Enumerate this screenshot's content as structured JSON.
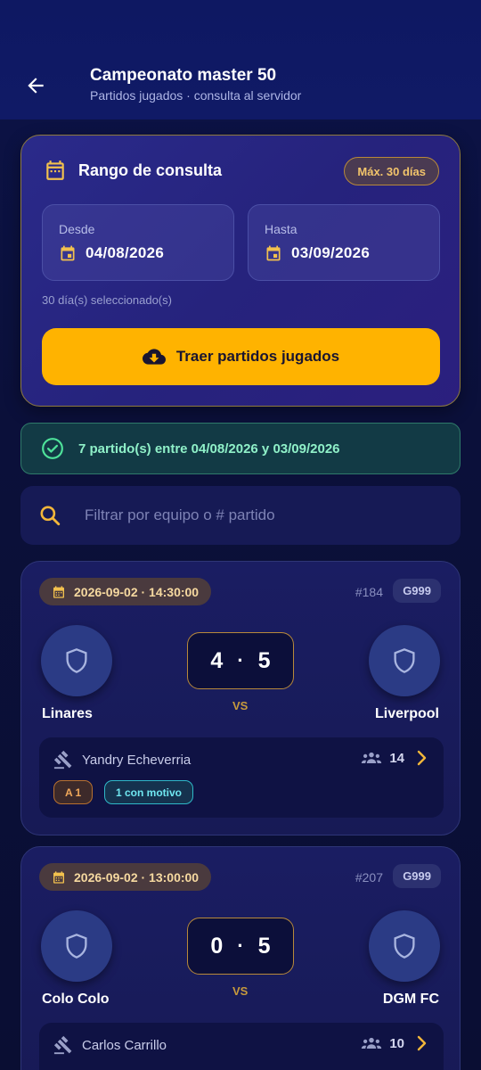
{
  "header": {
    "title": "Campeonato master 50",
    "subtitle": "Partidos jugados · consulta al servidor"
  },
  "range": {
    "title": "Rango de consulta",
    "max_badge": "Máx. 30 días",
    "from_label": "Desde",
    "from_value": "04/08/2026",
    "to_label": "Hasta",
    "to_value": "03/09/2026",
    "selected_count": "30 día(s) seleccionado(s)",
    "fetch_button": "Traer partidos jugados"
  },
  "result": {
    "text": "7 partido(s) entre 04/08/2026 y 03/09/2026"
  },
  "search": {
    "placeholder": "Filtrar por equipo o # partido",
    "value": ""
  },
  "matches": [
    {
      "datetime": "2026-09-02 · 14:30:00",
      "number": "#184",
      "group": "G999",
      "home": "Linares",
      "away": "Liverpool",
      "home_score": "4",
      "away_score": "5",
      "separator": "·",
      "vs": "VS",
      "referee": "Yandry Echeverria",
      "players": "14",
      "tags": [
        "A 1",
        "1 con motivo"
      ]
    },
    {
      "datetime": "2026-09-02 · 13:00:00",
      "number": "#207",
      "group": "G999",
      "home": "Colo Colo",
      "away": "DGM FC",
      "home_score": "0",
      "away_score": "5",
      "separator": "·",
      "vs": "VS",
      "referee": "Carlos Carrillo",
      "players": "10",
      "tags": []
    }
  ],
  "colors": {
    "accent": "#ffb300",
    "success": "#8ff0c8",
    "card_border": "#8e7a3e"
  },
  "icons": {
    "back": "arrow-left-icon",
    "calendar": "calendar-icon",
    "cloud": "cloud-download-icon",
    "check": "check-circle-icon",
    "search": "search-icon",
    "shield": "shield-icon",
    "gavel": "gavel-icon",
    "people": "people-icon",
    "chevron": "chevron-right-icon"
  }
}
